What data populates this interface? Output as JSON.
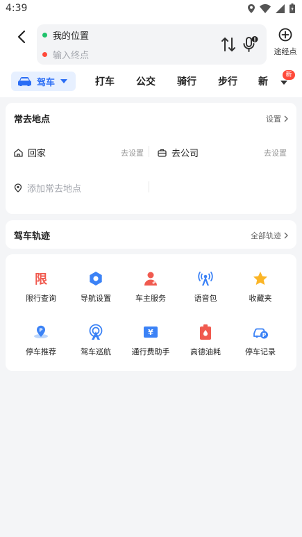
{
  "status_bar": {
    "time": "4:39"
  },
  "header": {
    "start_label": "我的位置",
    "end_placeholder": "输入终点",
    "waypoint_label": "途经点",
    "colors": {
      "start_dot": "#1ec26b",
      "end_dot": "#ff4a3a"
    }
  },
  "mode_tabs": {
    "active": "驾车",
    "items": [
      "打车",
      "公交",
      "骑行",
      "步行",
      "新"
    ],
    "new_badge": "新",
    "accent": "#2a6df5"
  },
  "favorites": {
    "title": "常去地点",
    "settings_label": "设置",
    "home_label": "回家",
    "home_action": "去设置",
    "work_label": "去公司",
    "work_action": "去设置",
    "add_label": "添加常去地点"
  },
  "tracks": {
    "title": "驾车轨迹",
    "all_label": "全部轨迹"
  },
  "tools": {
    "items": [
      {
        "label": "限行查询",
        "icon": "restriction-icon",
        "glyph": "限"
      },
      {
        "label": "导航设置",
        "icon": "nav-settings-icon"
      },
      {
        "label": "车主服务",
        "icon": "owner-service-icon"
      },
      {
        "label": "语音包",
        "icon": "voice-pack-icon"
      },
      {
        "label": "收藏夹",
        "icon": "star-icon"
      },
      {
        "label": "停车推荐",
        "icon": "parking-icon",
        "glyph": "P"
      },
      {
        "label": "驾车巡航",
        "icon": "cruise-icon"
      },
      {
        "label": "通行费助手",
        "icon": "toll-icon",
        "glyph": "¥"
      },
      {
        "label": "高德油耗",
        "icon": "fuel-icon"
      },
      {
        "label": "停车记录",
        "icon": "parking-record-icon",
        "glyph": "P"
      }
    ]
  }
}
